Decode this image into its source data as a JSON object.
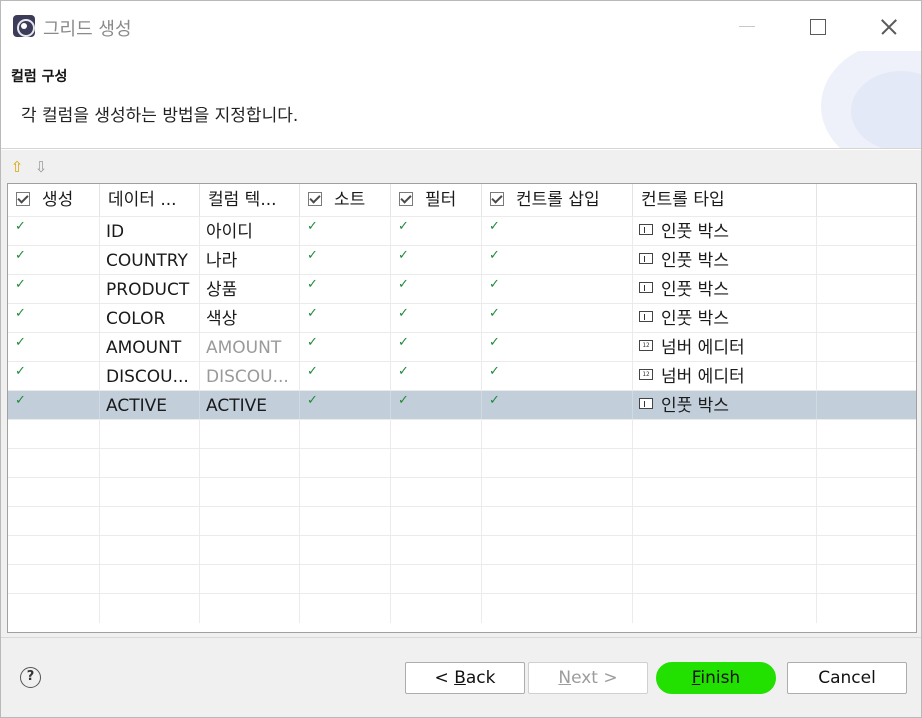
{
  "window": {
    "title": "그리드 생성",
    "minimize_label": "",
    "maximize_label": "",
    "close_label": ""
  },
  "header": {
    "title": "컬럼 구성",
    "description": "각 컬럼을 생성하는 방법을 지정합니다."
  },
  "toolbar": {
    "move_up_icon": "arrow-up-icon",
    "move_down_icon": "arrow-down-icon"
  },
  "grid": {
    "columns": [
      {
        "label": "생성",
        "checkbox": true
      },
      {
        "label": "데이터 ...",
        "checkbox": false
      },
      {
        "label": "컬럼 텍...",
        "checkbox": false
      },
      {
        "label": "소트",
        "checkbox": true
      },
      {
        "label": "필터",
        "checkbox": true
      },
      {
        "label": "컨트롤 삽입",
        "checkbox": true
      },
      {
        "label": "컨트롤 타입",
        "checkbox": false
      }
    ],
    "rows": [
      {
        "create": true,
        "data": "ID",
        "text": "아이디",
        "text_dim": false,
        "sort": true,
        "filter": true,
        "insert": true,
        "control_icon": "input-box-icon",
        "control": "인풋 박스",
        "selected": false
      },
      {
        "create": true,
        "data": "COUNTRY",
        "text": "나라",
        "text_dim": false,
        "sort": true,
        "filter": true,
        "insert": true,
        "control_icon": "input-box-icon",
        "control": "인풋 박스",
        "selected": false
      },
      {
        "create": true,
        "data": "PRODUCT",
        "text": "상품",
        "text_dim": false,
        "sort": true,
        "filter": true,
        "insert": true,
        "control_icon": "input-box-icon",
        "control": "인풋 박스",
        "selected": false
      },
      {
        "create": true,
        "data": "COLOR",
        "text": "색상",
        "text_dim": false,
        "sort": true,
        "filter": true,
        "insert": true,
        "control_icon": "input-box-icon",
        "control": "인풋 박스",
        "selected": false
      },
      {
        "create": true,
        "data": "AMOUNT",
        "text": "AMOUNT",
        "text_dim": true,
        "sort": true,
        "filter": true,
        "insert": true,
        "control_icon": "number-editor-icon",
        "control": "넘버 에디터",
        "selected": false
      },
      {
        "create": true,
        "data": "DISCOU...",
        "text": "DISCOU...",
        "text_dim": true,
        "sort": true,
        "filter": true,
        "insert": true,
        "control_icon": "number-editor-icon",
        "control": "넘버 에디터",
        "selected": false
      },
      {
        "create": true,
        "data": "ACTIVE",
        "text": "ACTIVE",
        "text_dim": false,
        "sort": true,
        "filter": true,
        "insert": true,
        "control_icon": "input-box-icon",
        "control": "인풋 박스",
        "selected": true
      }
    ],
    "number_icon_text": "12"
  },
  "footer": {
    "help_label": "?",
    "back": {
      "prefix": "< ",
      "mnemonic": "B",
      "rest": "ack"
    },
    "next": {
      "mnemonic": "N",
      "rest": "ext >"
    },
    "finish": {
      "mnemonic": "F",
      "rest": "inish"
    },
    "cancel": "Cancel"
  },
  "colors": {
    "selected_row": "#c2cfdb",
    "check": "#1e8a3a",
    "finish_highlight": "#22e000"
  }
}
